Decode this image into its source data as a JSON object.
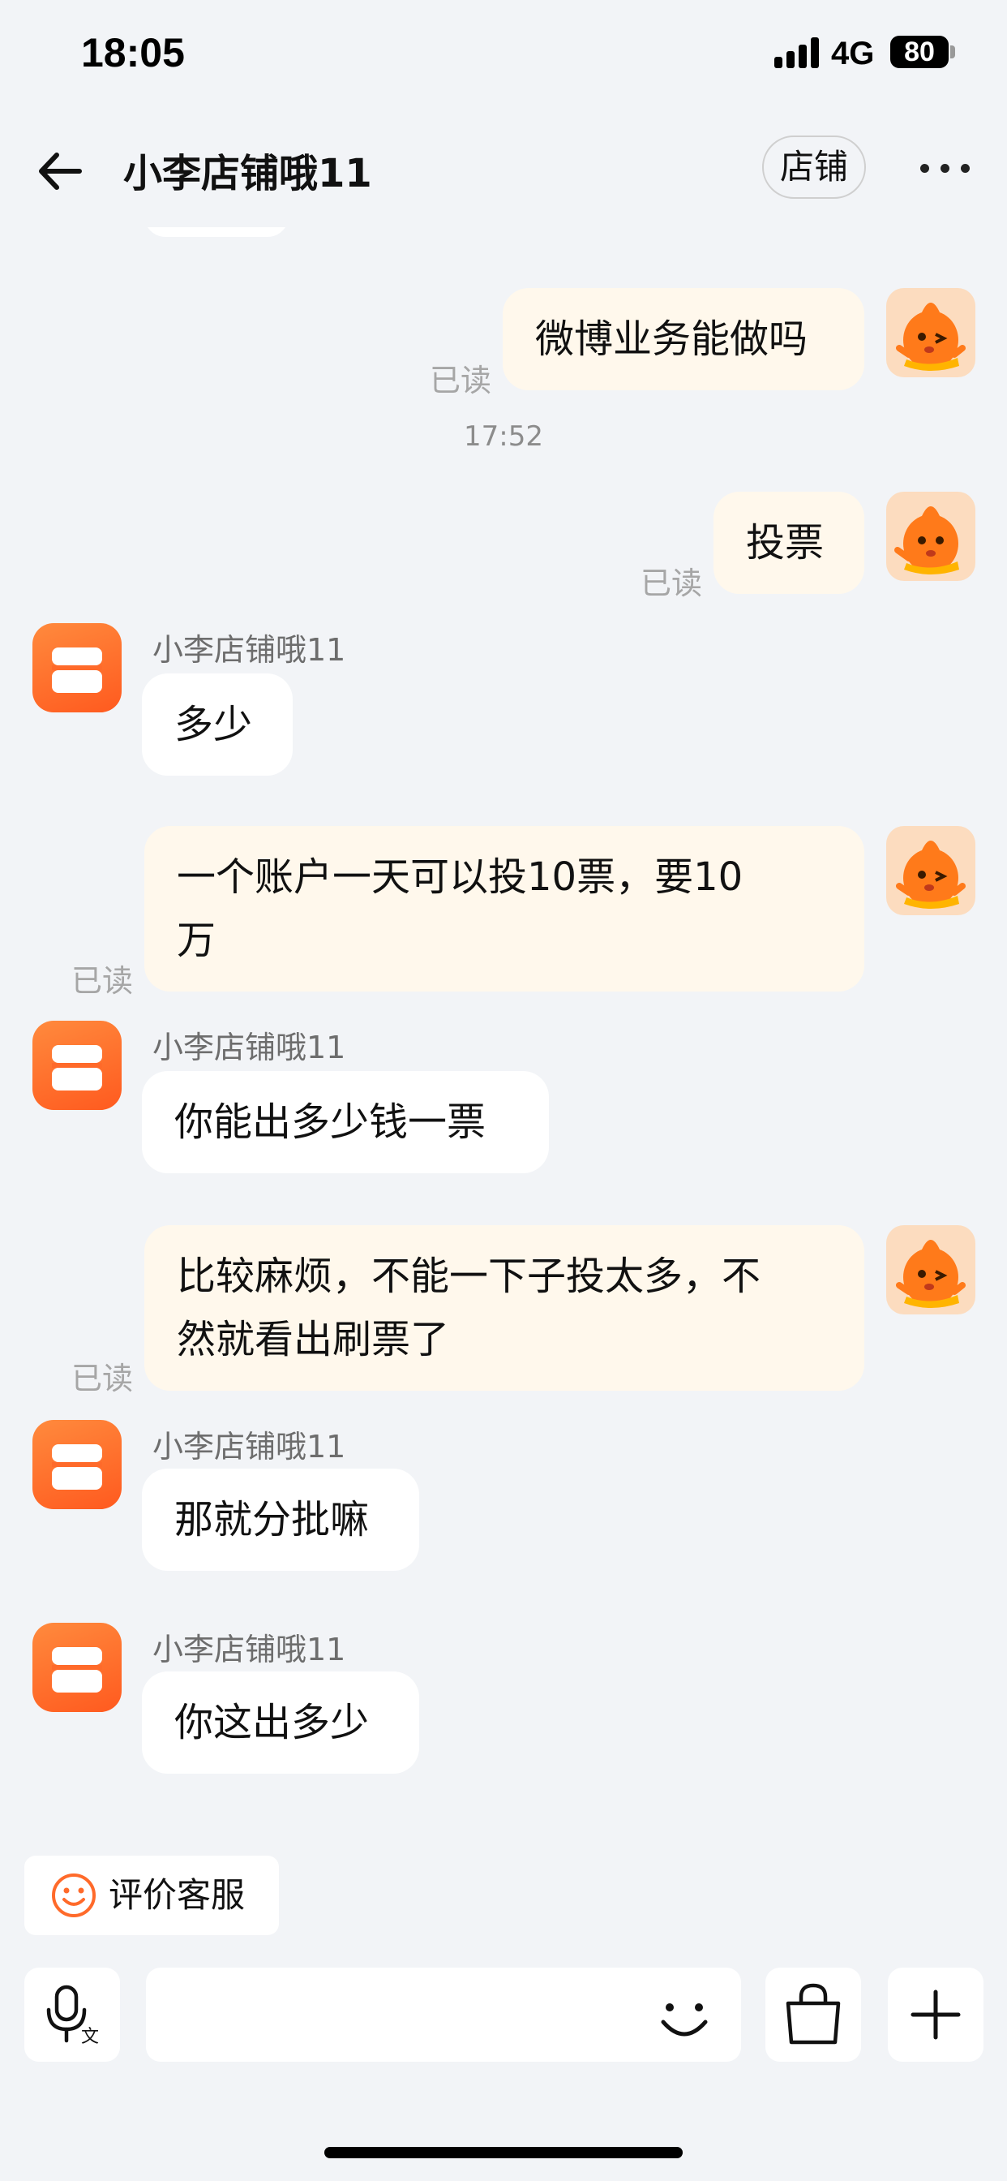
{
  "status_bar": {
    "time": "18:05",
    "network": "4G",
    "battery": "80"
  },
  "header": {
    "title": "小李店铺哦11",
    "shop_button": "店铺",
    "back_icon": "back-arrow-icon",
    "more_icon": "more-dots-icon"
  },
  "messages": [
    {
      "from": "self",
      "text": "微博业务能做吗",
      "status": "已读"
    },
    {
      "type": "time",
      "text": "17:52"
    },
    {
      "from": "self",
      "text": "投票",
      "status": "已读"
    },
    {
      "from": "shop",
      "sender": "小李店铺哦11",
      "text": "多少"
    },
    {
      "from": "self",
      "lines": [
        "一个账户一天可以投10票，要10",
        "万"
      ],
      "status": "已读"
    },
    {
      "from": "shop",
      "sender": "小李店铺哦11",
      "text": "你能出多少钱一票"
    },
    {
      "from": "self",
      "lines": [
        "比较麻烦，不能一下子投太多，不",
        "然就看出刷票了"
      ],
      "status": "已读"
    },
    {
      "from": "shop",
      "sender": "小李店铺哦11",
      "text": "那就分批嘛"
    },
    {
      "from": "shop",
      "sender": "小李店铺哦11",
      "text": "你这出多少"
    }
  ],
  "bottom": {
    "rate_label": "评价客服",
    "rate_icon": "smile-icon",
    "input_value": "",
    "icons": [
      "voice-to-text-icon",
      "emoji-icon",
      "shopping-bag-icon",
      "plus-icon"
    ]
  },
  "colors": {
    "background": "#f2f4f7",
    "self_bubble": "#fff8ec",
    "other_bubble": "#ffffff",
    "accent": "#ff6a2a",
    "read_text": "#a6a6a6"
  }
}
